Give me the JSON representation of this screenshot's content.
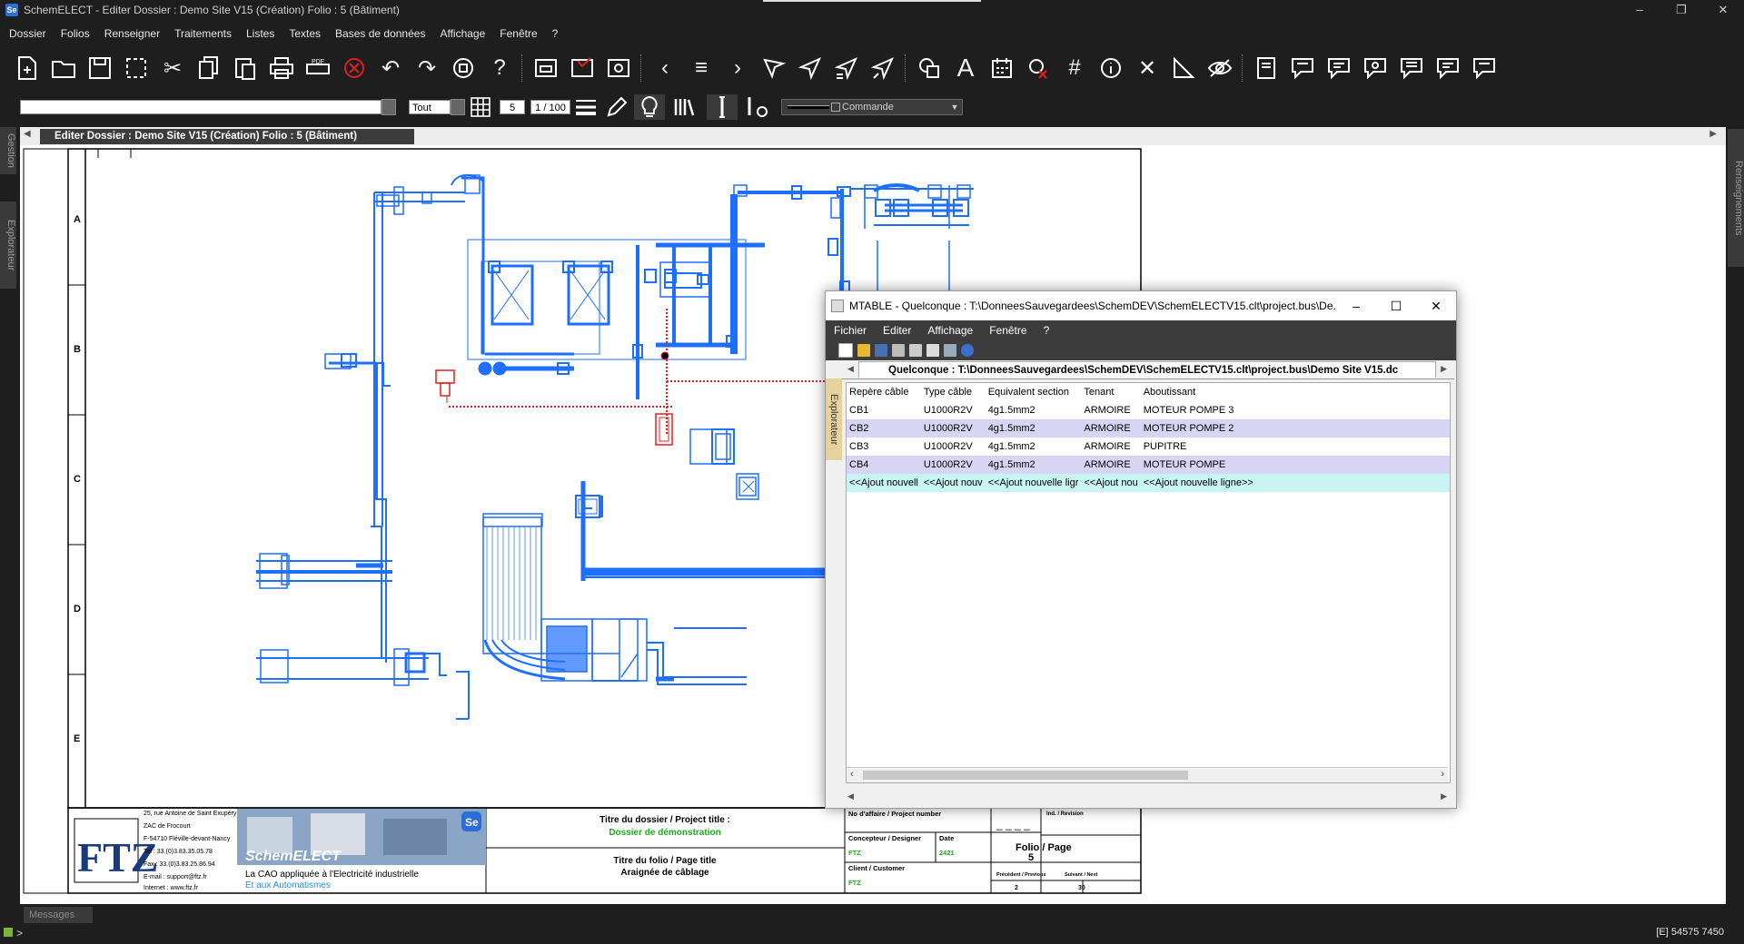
{
  "window": {
    "title": "SchemELECT - Editer  Dossier : Demo Site V15  (Création)  Folio : 5  (Bâtiment)",
    "controls": [
      "–",
      "❐",
      "✕"
    ]
  },
  "menu": [
    "Dossier",
    "Folios",
    "Renseigner",
    "Traitements",
    "Listes",
    "Textes",
    "Bases de données",
    "Affichage",
    "Fenêtre",
    "?"
  ],
  "toolbar2": {
    "layer_value": "",
    "filter_value": "Tout",
    "grid_step": "5",
    "scale": "1 / 100",
    "command_placeholder": "Commande"
  },
  "doc_tab": "Editer  Dossier : Demo Site V15  (Création)  Folio : 5  (Bâtiment)",
  "side_tabs": {
    "left_top": "Gestion",
    "left_bottom": "Explorateur",
    "right": "Renseignements"
  },
  "sheet": {
    "rows": [
      "A",
      "B",
      "C",
      "D",
      "E"
    ]
  },
  "cartouche": {
    "address_lines": [
      "25, rue Antoine de Saint Exupéry",
      "ZAC de Frocourt",
      "F-54710 Fléville-devant-Nancy",
      "Tel : 33.(0)3.83.35.05.78",
      "Fax : 33.(0)3.83.25.86.94",
      "E-mail : support@ftz.fr",
      "Internet : www.ftz.fr"
    ],
    "logo": "FTZ",
    "banner_title": "SchemELECT",
    "banner_line1": "La CAO appliquée à l'Electricité industrielle",
    "banner_line2": "Et aux Automatismes",
    "banner_badge": "Se",
    "project_label": "Titre du dossier / Project title :",
    "project_value": "Dossier de démonstration",
    "folio_label": "Titre du folio / Page title",
    "folio_value": "Araignée de câblage",
    "affaire_label": "No d'affaire / Project number",
    "affaire_value": "_ _ _ _",
    "ind_label": "Ind. / Revision",
    "designer_label": "Concepteur / Designer",
    "designer_value": "FTZ",
    "date_label": "Date",
    "date_value": "2421",
    "client_label": "Client / Customer",
    "client_value": "FTZ",
    "folio_page_label": "Folio / Page",
    "folio_page_value": "5",
    "prev_label": "Précédent / Previous",
    "prev_value": "2",
    "next_label": "Suivant / Next",
    "next_value": "30"
  },
  "mtable": {
    "title": "MTABLE - Quelconque : T:\\DonneesSauvegardees\\SchemDEV\\SchemELECTV15.clt\\project.bus\\De...",
    "menu": [
      "Fichier",
      "Editer",
      "Affichage",
      "Fenêtre",
      "?"
    ],
    "path_tab": "Quelconque : T:\\DonneesSauvegardees\\SchemDEV\\SchemELECTV15.clt\\project.bus\\Demo Site V15.dc",
    "side_tab": "Explorateur",
    "columns": [
      "Repère câble",
      "Type câble",
      "Equivalent section",
      "Tenant",
      "Aboutissant"
    ],
    "rows": [
      [
        "CB1",
        "U1000R2V",
        "4g1.5mm2",
        "ARMOIRE",
        "MOTEUR POMPE 3"
      ],
      [
        "CB2",
        "U1000R2V",
        "4g1.5mm2",
        "ARMOIRE",
        "MOTEUR POMPE 2"
      ],
      [
        "CB3",
        "U1000R2V",
        "4g1.5mm2",
        "ARMOIRE",
        "PUPITRE"
      ],
      [
        "CB4",
        "U1000R2V",
        "4g1.5mm2",
        "ARMOIRE",
        "MOTEUR POMPE"
      ]
    ],
    "add_row": [
      "<<Ajout nouvell",
      "<<Ajout nouv",
      "<<Ajout nouvelle ligr",
      "<<Ajout nou",
      "<<Ajout nouvelle ligne>>"
    ]
  },
  "messages_tab": "Messages",
  "status": {
    "left": ">",
    "coords": "[E]  54575  7450"
  },
  "colors": {
    "drawing": "#1f6fff",
    "selection": "#e02020",
    "row_alt": "#d8d4f4",
    "add_row": "#c8f4f4"
  }
}
